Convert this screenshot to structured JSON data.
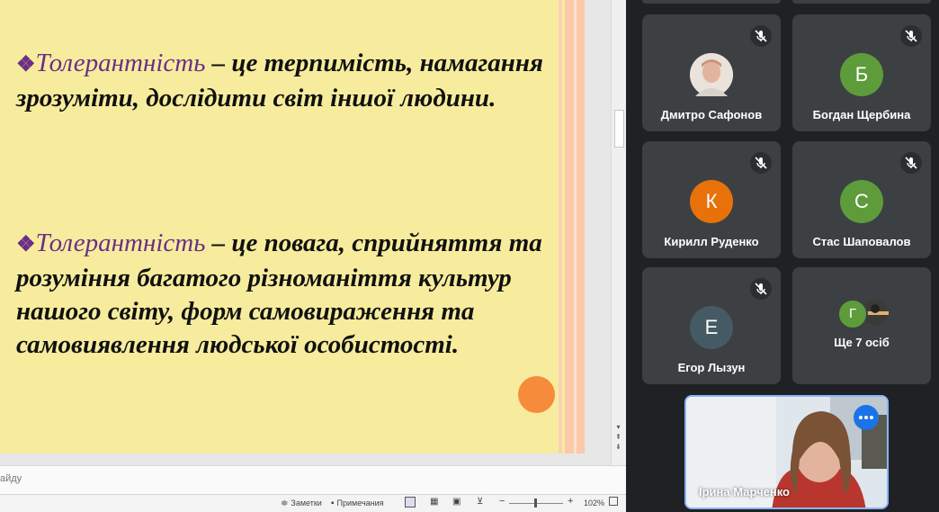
{
  "slide": {
    "bullet_symbol": "❖",
    "paragraphs": [
      {
        "term": "Толерантність",
        "text": " – це терпимість, намагання зрозуміти, дослідити світ іншої людини."
      },
      {
        "term": "Толерантність",
        "text": " – це повага, сприйняття та розуміння багатого різноманіття культур нашого світу, форм самовираження та самовиявлення людської особистості."
      }
    ],
    "colors": {
      "background": "#f7ec9d",
      "term": "#6a2f86",
      "text": "#111111",
      "accent_dot": "#f68b3b"
    }
  },
  "notes": {
    "placeholder": "айду"
  },
  "statusbar": {
    "notes_label": "Заметки",
    "comments_label": "Примечания",
    "zoom": "102%"
  },
  "participants": [
    {
      "name": "Дмитро Сафонов",
      "initial": "",
      "avatar_color": "",
      "muted": true,
      "has_photo": true
    },
    {
      "name": "Богдан Щербина",
      "initial": "Б",
      "avatar_color": "#5e9c3b",
      "muted": true
    },
    {
      "name": "Кирилл Руденко",
      "initial": "К",
      "avatar_color": "#e8710a",
      "muted": true
    },
    {
      "name": "Стас Шаповалов",
      "initial": "С",
      "avatar_color": "#5e9c3b",
      "muted": true
    },
    {
      "name": "Егор Лызун",
      "initial": "Е",
      "avatar_color": "#455a64",
      "muted": true
    }
  ],
  "more_tile": {
    "label": "Ще 7 осіб",
    "initial": "Г",
    "initial_color": "#5e9c3b"
  },
  "self": {
    "name": "Ірина Марченко"
  },
  "meet_colors": {
    "panel_bg": "#202124",
    "tile_bg": "#3c4043",
    "self_border": "#8ab4f8",
    "options_button": "#1a73e8"
  }
}
